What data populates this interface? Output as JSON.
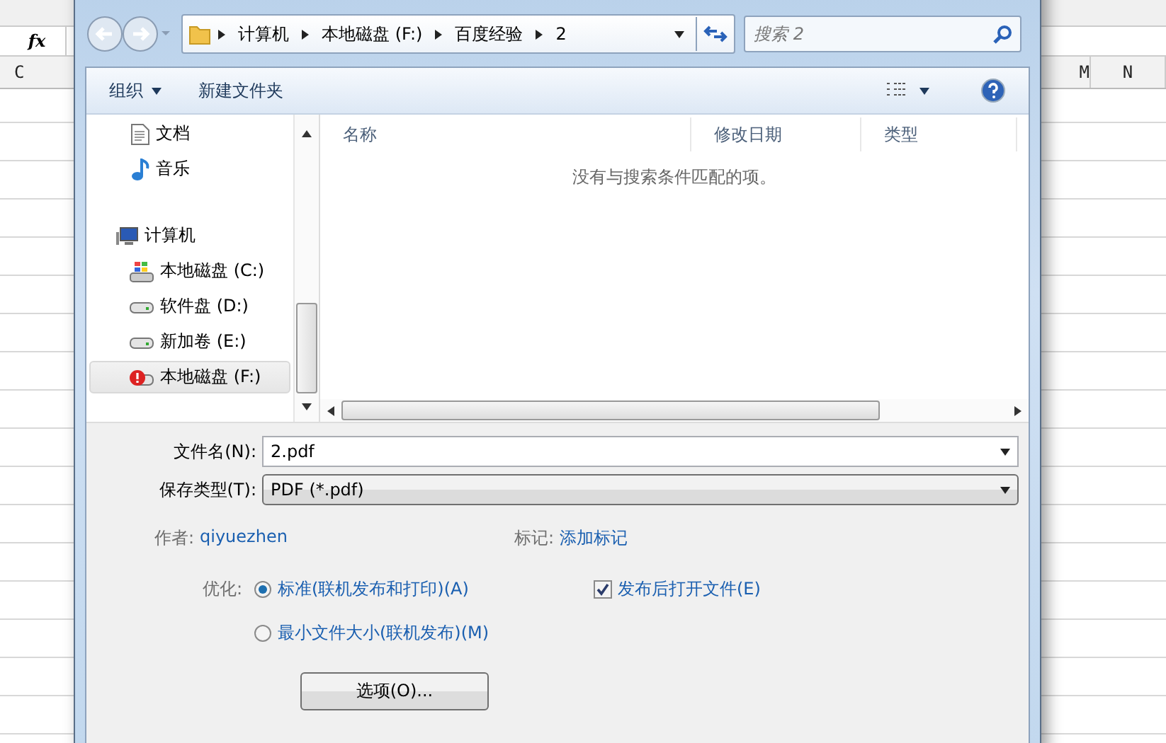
{
  "spreadsheet": {
    "formula_symbol": "fx",
    "left_columns": [
      "C"
    ],
    "right_columns": [
      "M",
      "N"
    ]
  },
  "dialog": {
    "breadcrumb": [
      "计算机",
      "本地磁盘 (F:)",
      "百度经验",
      "2"
    ],
    "search": {
      "placeholder": "搜索 2"
    },
    "toolbar": {
      "organize": "组织",
      "new_folder": "新建文件夹"
    },
    "libraries": [
      {
        "label": "文档",
        "kind": "document"
      },
      {
        "label": "音乐",
        "kind": "music"
      }
    ],
    "computer": {
      "label": "计算机",
      "children": [
        {
          "label": "本地磁盘 (C:)",
          "kind": "system",
          "selected": false
        },
        {
          "label": "软件盘 (D:)",
          "kind": "drive",
          "selected": false
        },
        {
          "label": "新加卷 (E:)",
          "kind": "drive",
          "selected": false
        },
        {
          "label": "本地磁盘 (F:)",
          "kind": "error",
          "selected": true
        }
      ]
    },
    "columns": [
      "名称",
      "修改日期",
      "类型"
    ],
    "empty_message": "没有与搜索条件匹配的项。",
    "file_name": {
      "label": "文件名(N):",
      "value": "2.pdf"
    },
    "save_type": {
      "label": "保存类型(T):",
      "value": "PDF (*.pdf)"
    },
    "author": {
      "label": "作者:",
      "value": "qiyuezhen"
    },
    "tags": {
      "label": "标记:",
      "value": "添加标记"
    },
    "optimize": {
      "label": "优化:",
      "options": [
        {
          "label": "标准(联机发布和打印)(A)",
          "selected": true
        },
        {
          "label": "最小文件大小(联机发布)(M)",
          "selected": false
        }
      ]
    },
    "open_after": {
      "label": "发布后打开文件(E)",
      "checked": true
    },
    "options_button": "选项(O)..."
  }
}
